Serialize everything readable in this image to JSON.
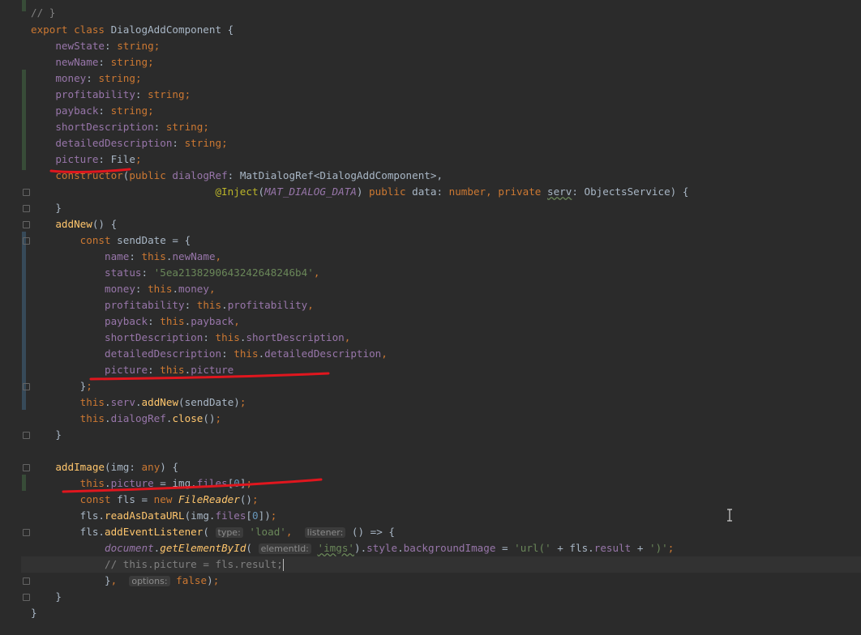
{
  "colors": {
    "background": "#2b2b2b",
    "keyword": "#cc7832",
    "property": "#9876aa",
    "function": "#ffc66d",
    "string": "#6a8759",
    "comment": "#808080",
    "annotation": "#bbb529",
    "number": "#6897bb",
    "default_text": "#a9b7c6",
    "underline_marker": "#e0161e"
  },
  "code": {
    "l0": "// }",
    "l1_kw": "export class ",
    "l1_name": "DialogAddComponent {",
    "fields": [
      {
        "name": "newState",
        "type": "string"
      },
      {
        "name": "newName",
        "type": "string"
      },
      {
        "name": "money",
        "type": "string"
      },
      {
        "name": "profitability",
        "type": "string"
      },
      {
        "name": "payback",
        "type": "string"
      },
      {
        "name": "shortDescription",
        "type": "string"
      },
      {
        "name": "detailedDescription",
        "type": "string"
      },
      {
        "name": "picture",
        "type": "File"
      }
    ],
    "ctor_kw": "constructor",
    "ctor_public": "public ",
    "ctor_param": "dialogRef",
    "ctor_type": "MatDialogRef<DialogAddComponent>,",
    "inject_ann": "@Inject",
    "inject_const": "MAT_DIALOG_DATA",
    "inject_public": "public ",
    "inject_data": "data",
    "inject_number": "number",
    "inject_private": "private ",
    "inject_serv": "serv",
    "inject_type": "ObjectsService",
    "close_brace": "}",
    "addnew_fn": "addNew",
    "const_kw": "const ",
    "senddate_var": "sendDate",
    "obj": [
      {
        "key": "name",
        "val": "newName"
      },
      {
        "key": "status",
        "str": "'5ea2138290643242648246b4'"
      },
      {
        "key": "money",
        "val": "money"
      },
      {
        "key": "profitability",
        "val": "profitability"
      },
      {
        "key": "payback",
        "val": "payback"
      },
      {
        "key": "shortDescription",
        "val": "shortDescription"
      },
      {
        "key": "detailedDescription",
        "val": "detailedDescription"
      },
      {
        "key": "picture",
        "val": "picture"
      }
    ],
    "this_kw": "this",
    "serv": "serv",
    "addnew_call": "addNew",
    "dialogref": "dialogRef",
    "close_call": "close",
    "addimage_fn": "addImage",
    "img_param": "img",
    "any_type": "any",
    "files": "files",
    "zero": "0",
    "new_kw": "new ",
    "filereader": "FileReader",
    "fls": "fls",
    "readasdataurl": "readAsDataURL",
    "addeventlistener": "addEventListener",
    "hint_type": "type:",
    "load_str": "'load'",
    "hint_listener": "listener:",
    "document": "document",
    "getelementbyid": "getElementById",
    "hint_elementid": "elementId:",
    "imgs_str": "'imgs'",
    "style": "style",
    "backgroundimage": "backgroundImage",
    "url_open": "'url('",
    "result": "result",
    "url_close": "')'",
    "comment_line": "// this.picture = fls.result;",
    "hint_options": "options:",
    "false_kw": "false"
  }
}
